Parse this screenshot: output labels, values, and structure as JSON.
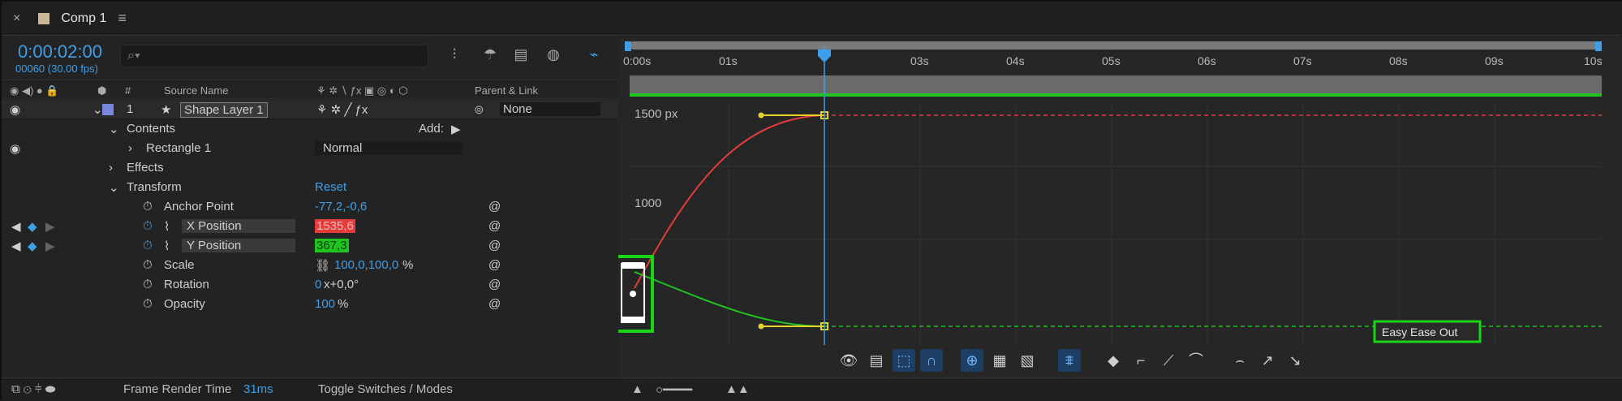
{
  "tab": {
    "title": "Comp 1",
    "menu_icon": "hamburger-icon",
    "swatch_color": "#c8b897"
  },
  "timecode": "0:00:02:00",
  "frame_info": "00060 (30.00 fps)",
  "search": {
    "placeholder": "",
    "icon": "search-icon"
  },
  "column_headers": {
    "num": "#",
    "source_name": "Source Name",
    "parent_link": "Parent & Link"
  },
  "layer": {
    "index": "1",
    "name": "Shape Layer 1",
    "parent": "None",
    "label_color": "#7a86dd"
  },
  "properties": {
    "contents": "Contents",
    "add_label": "Add:",
    "rectangle": "Rectangle 1",
    "blend_mode": "Normal",
    "effects": "Effects",
    "transform": "Transform",
    "reset": "Reset",
    "anchor_label": "Anchor Point",
    "anchor_value": "-77,2,-0,6",
    "xpos_label": "X Position",
    "xpos_value": "1535,6",
    "ypos_label": "Y Position",
    "ypos_value": "367,3",
    "scale_label": "Scale",
    "scale_value": "100,0,100,0",
    "scale_unit": "%",
    "rotation_label": "Rotation",
    "rotation_x": "0",
    "rotation_value": "x+0,0°",
    "opacity_label": "Opacity",
    "opacity_value": "100",
    "opacity_unit": "%"
  },
  "timeline": {
    "ruler": [
      "0:00s",
      "01s",
      "03s",
      "04s",
      "05s",
      "06s",
      "07s",
      "08s",
      "09s",
      "10s"
    ],
    "y_labels": [
      "1500 px",
      "1000"
    ],
    "tooltip": "Easy Ease Out"
  },
  "status": {
    "frame_render_label": "Frame Render Time",
    "frame_render_value": "31ms",
    "toggle_label": "Toggle Switches / Modes"
  },
  "colors": {
    "accent": "#3e9fe8",
    "x_curve": "#e53b3b",
    "y_curve": "#1fc41f",
    "highlight_box": "#16d616"
  }
}
